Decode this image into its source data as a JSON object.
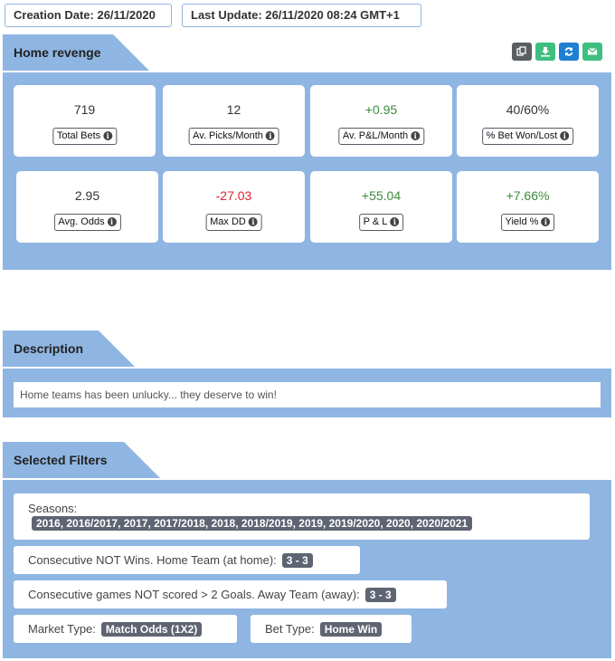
{
  "header": {
    "creation_date": "Creation Date: 26/11/2020",
    "last_update": "Last Update: 26/11/2020 08:24 GMT+1"
  },
  "strategy": {
    "title": "Home revenge",
    "toolbar": [
      {
        "name": "copy-button",
        "icon": "copy-icon",
        "color": "#5a5e60"
      },
      {
        "name": "download-button",
        "icon": "download-icon",
        "color": "#3fbf7f"
      },
      {
        "name": "refresh-button",
        "icon": "refresh-icon",
        "color": "#1f7fd0"
      },
      {
        "name": "email-button",
        "icon": "envelope-icon",
        "color": "#3fbf7f"
      }
    ],
    "stats": [
      {
        "value": "719",
        "label": "Total Bets",
        "tone": "neutral"
      },
      {
        "value": "12",
        "label": "Av. Picks/Month",
        "tone": "neutral"
      },
      {
        "value": "+0.95",
        "label": "Av. P&L/Month",
        "tone": "positive"
      },
      {
        "value": "40/60%",
        "label": "% Bet Won/Lost",
        "tone": "neutral"
      },
      {
        "value": "2.95",
        "label": "Avg. Odds",
        "tone": "neutral"
      },
      {
        "value": "-27.03",
        "label": "Max DD",
        "tone": "negative"
      },
      {
        "value": "+55.04",
        "label": "P & L",
        "tone": "positive"
      },
      {
        "value": "+7.66%",
        "label": "Yield %",
        "tone": "positive"
      }
    ]
  },
  "description": {
    "title": "Description",
    "text": "Home teams has been unlucky... they deserve to win!"
  },
  "filters": {
    "title": "Selected Filters",
    "seasons_label": "Seasons:",
    "seasons_value": "2016, 2016/2017, 2017, 2017/2018, 2018, 2018/2019, 2019, 2019/2020, 2020, 2020/2021",
    "consecutive_not_wins_label": "Consecutive NOT Wins. Home Team (at home):",
    "consecutive_not_wins_value": "3 - 3",
    "consecutive_not_scored_label": "Consecutive games NOT scored > 2 Goals. Away Team (away):",
    "consecutive_not_scored_value": "3 - 3",
    "market_type_label": "Market Type:",
    "market_type_value": "Match Odds (1X2)",
    "bet_type_label": "Bet Type:",
    "bet_type_value": "Home Win"
  }
}
